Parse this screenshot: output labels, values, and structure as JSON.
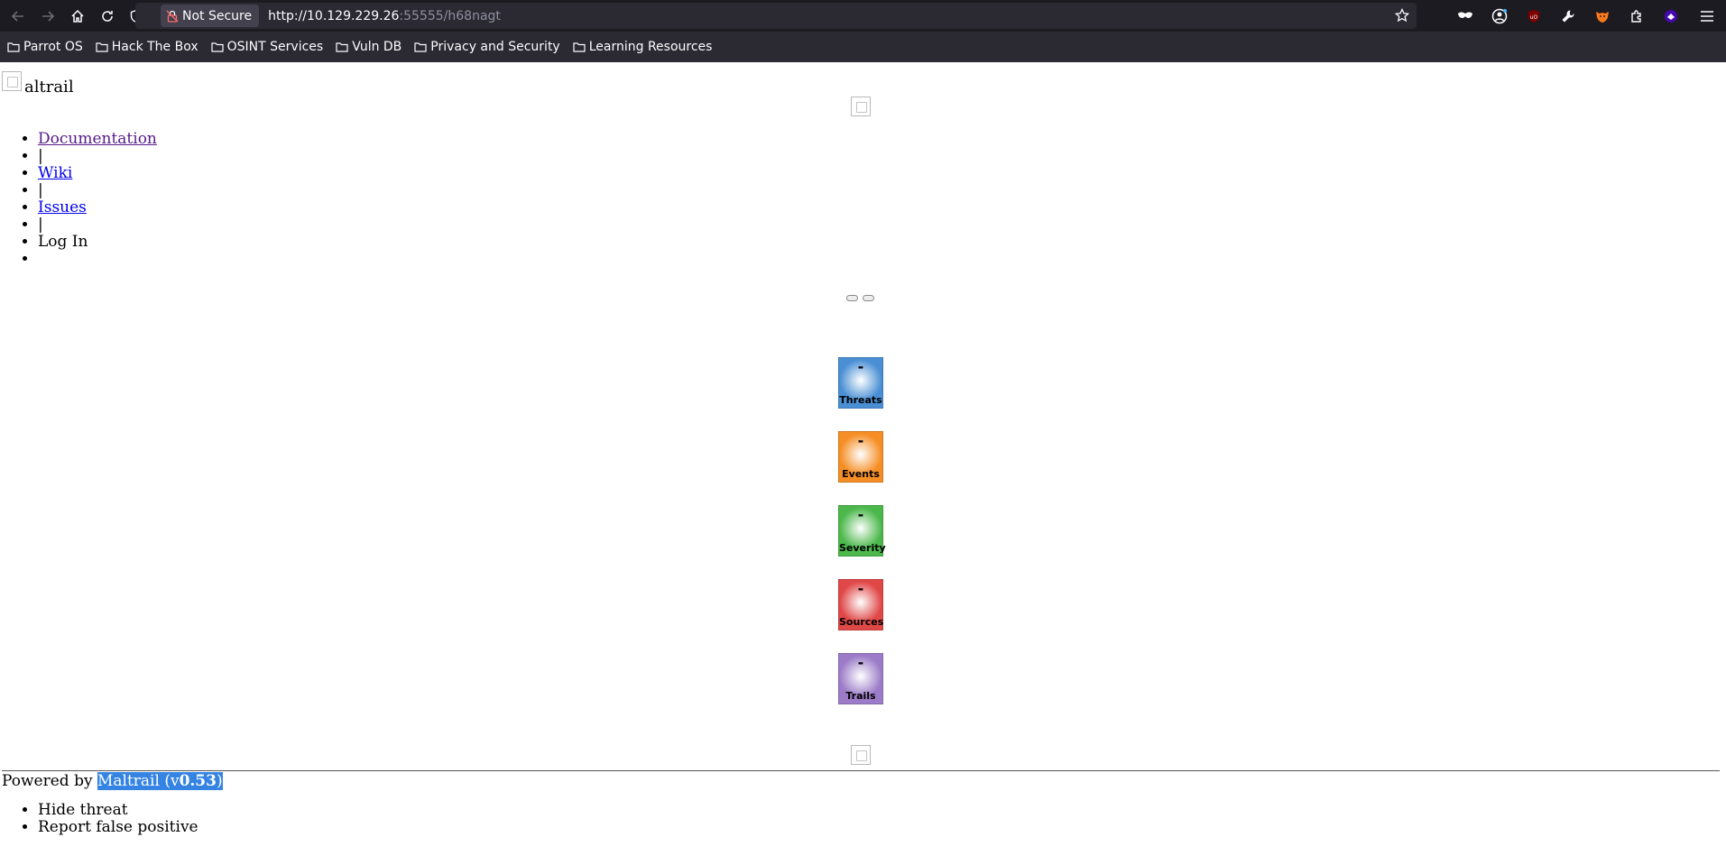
{
  "browser": {
    "security_label": "Not Secure",
    "url_host": "http://10.129.229.26",
    "url_rest": ":55555/h68nagt",
    "bookmarks": [
      {
        "label": "Parrot OS"
      },
      {
        "label": "Hack The Box"
      },
      {
        "label": "OSINT Services"
      },
      {
        "label": "Vuln DB"
      },
      {
        "label": "Privacy and Security"
      },
      {
        "label": "Learning Resources"
      }
    ]
  },
  "page": {
    "logo_text": "altrail",
    "nav": {
      "documentation": "Documentation",
      "sep1": "|",
      "wiki": "Wiki",
      "sep2": "|",
      "issues": "Issues",
      "sep3": "|",
      "login": "Log In"
    },
    "stats": [
      {
        "value": "-",
        "label": "Threats",
        "color": "#4a8fd4"
      },
      {
        "value": "-",
        "label": "Events",
        "color": "#f58e25"
      },
      {
        "value": "-",
        "label": "Severity",
        "color": "#4cb84c"
      },
      {
        "value": "-",
        "label": "Sources",
        "color": "#e04848"
      },
      {
        "value": "-",
        "label": "Trails",
        "color": "#9c7cc8"
      }
    ],
    "footer": {
      "powered_by": "Powered by ",
      "product_a": "Maltrail (v",
      "version": "0.53",
      "product_b": ")"
    },
    "context_menu": {
      "hide_threat": "Hide threat",
      "report_false_positive": "Report false positive"
    }
  }
}
